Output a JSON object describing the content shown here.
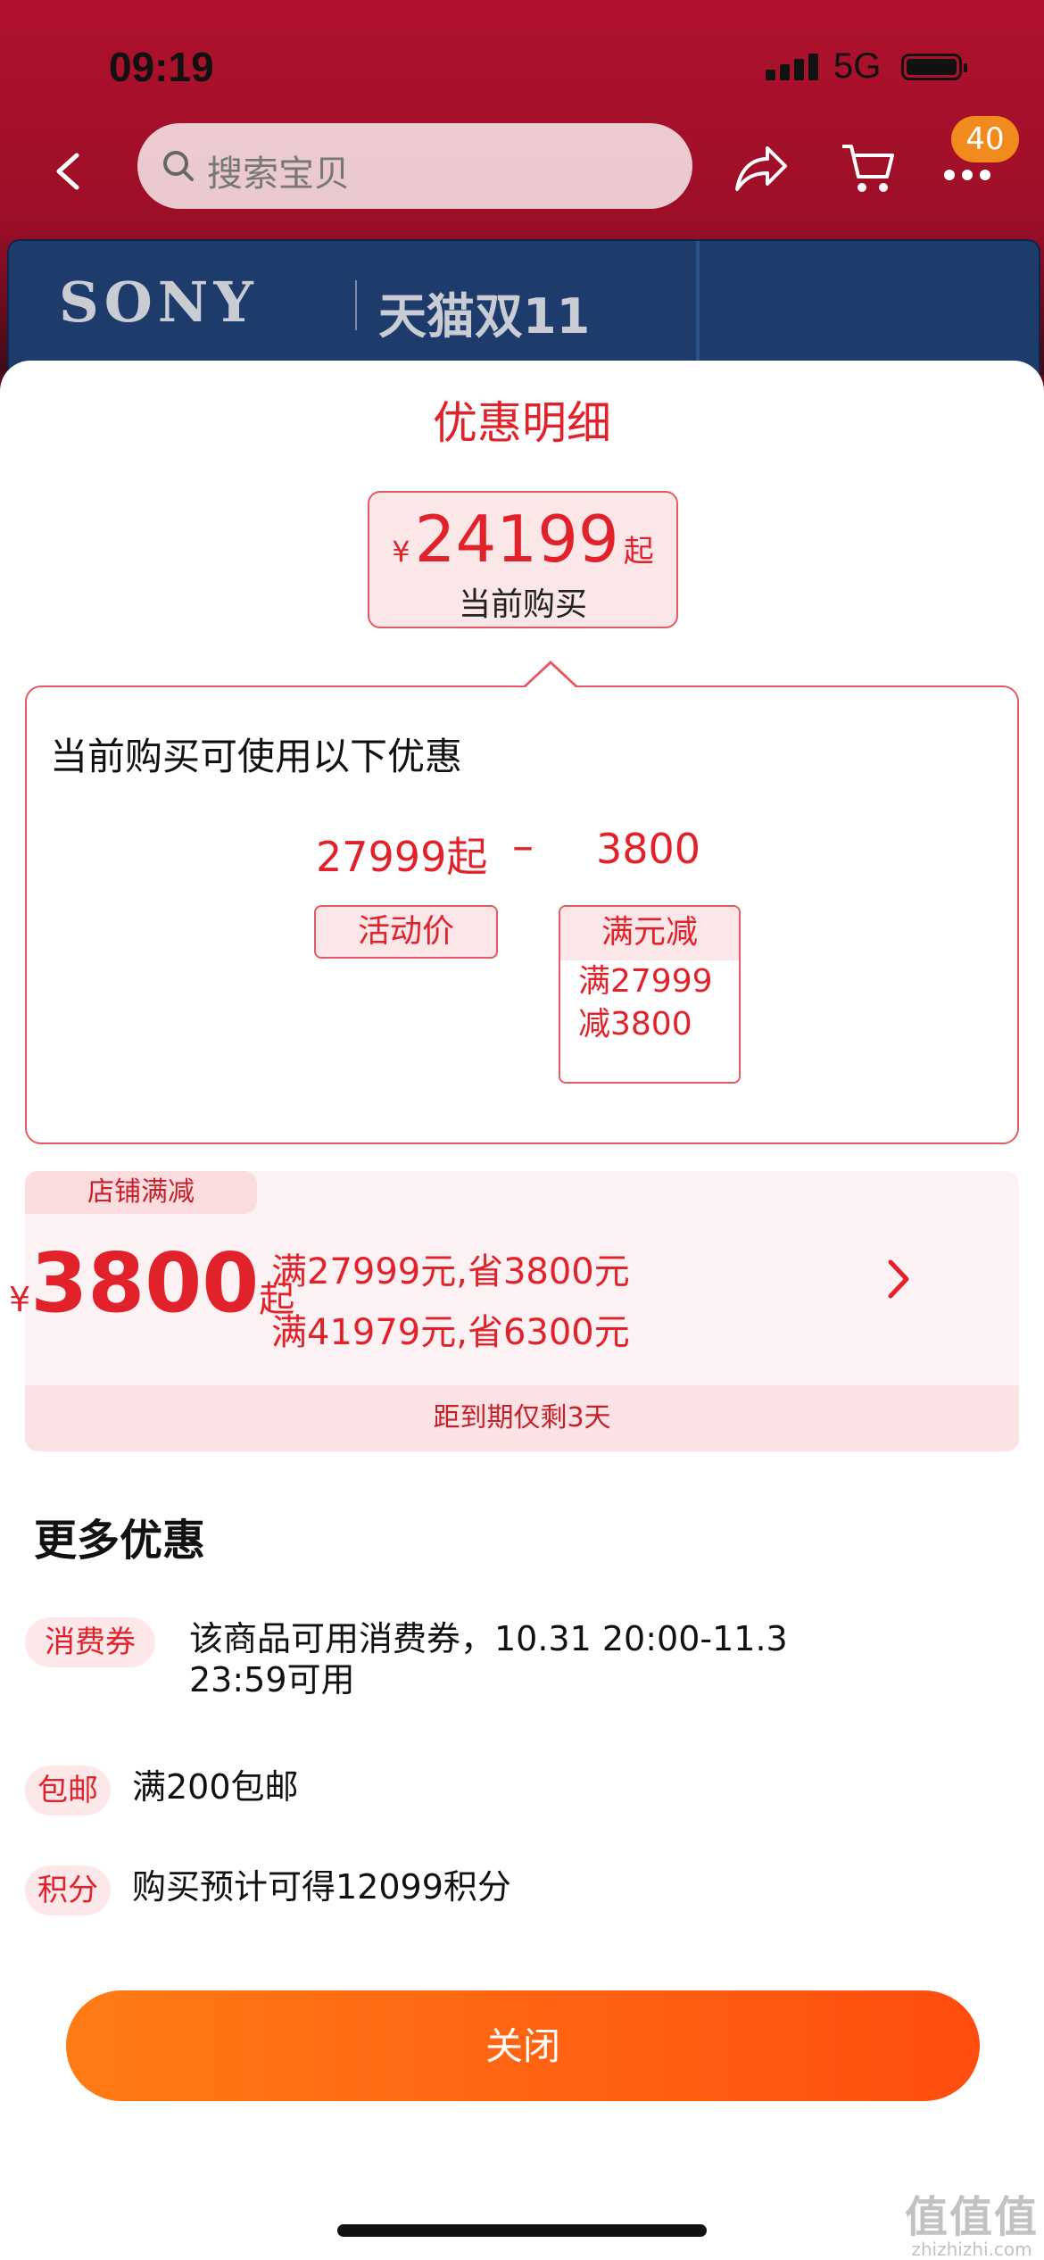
{
  "status_bar": {
    "time": "09:19",
    "network": "5G"
  },
  "nav": {
    "search_placeholder": "搜索宝贝",
    "cart_badge": "40"
  },
  "banner": {
    "brand": "SONY",
    "event": "天猫双11"
  },
  "sheet": {
    "title": "优惠明细",
    "current_price": {
      "currency": "¥",
      "value": "24199",
      "suffix": "起",
      "label": "当前购买"
    },
    "detail": {
      "heading": "当前购买可使用以下优惠",
      "activity_value": "27999起",
      "minus": "–",
      "discount_value": "3800",
      "activity_tag": "活动价",
      "discount_tag": {
        "title": "满元减",
        "line1": "满27999",
        "line2": "减3800"
      }
    },
    "shop_promo": {
      "tab_label": "店铺满减",
      "currency": "¥",
      "amount": "3800",
      "suffix": "起",
      "rule1": "满27999元,省3800元",
      "rule2": "满41979元,省6300元",
      "expiry": "距到期仅剩3天"
    },
    "more": {
      "title": "更多优惠",
      "items": [
        {
          "tag": "消费券",
          "text_line1": "该商品可用消费券，10.31 20:00-11.3",
          "text_line2": "23:59可用"
        },
        {
          "tag": "包邮",
          "text_line1": "满200包邮"
        },
        {
          "tag": "积分",
          "text_line1": "购买预计可得12099积分"
        }
      ]
    },
    "close_label": "关闭"
  },
  "watermark": {
    "big": "值值值",
    "small": "zhizhizhi.com"
  },
  "colors": {
    "accent": "#e1222b",
    "button_start": "#ff7b14",
    "button_end": "#ff4d10",
    "pill_bg": "#fde8e9"
  },
  "icons": [
    "back-icon",
    "search-icon",
    "share-icon",
    "cart-icon",
    "more-icon",
    "chevron-right-icon"
  ]
}
